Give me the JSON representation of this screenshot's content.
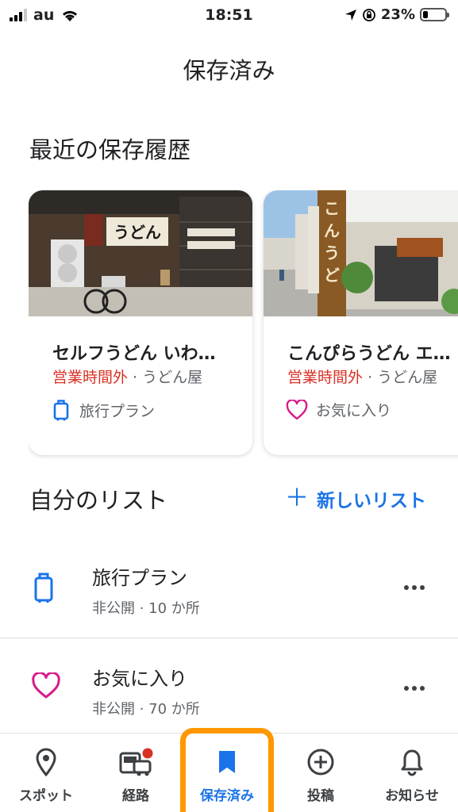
{
  "status_bar": {
    "carrier": "au",
    "time": "18:51",
    "battery": "23%",
    "battery_level": 0.23
  },
  "header": {
    "title": "保存済み"
  },
  "recent": {
    "title": "最近の保存履歴",
    "cards": [
      {
        "name": "セルフうどん いわ…",
        "status": "営業時間外",
        "separator": " · ",
        "category": "うどん屋",
        "list_label": "旅行プラン",
        "list_icon": "luggage-icon",
        "sign_text": "うどん"
      },
      {
        "name": "こんぴらうどん エ…",
        "status": "営業時間外",
        "separator": " · ",
        "category": "うどん屋",
        "list_label": "お気に入り",
        "list_icon": "heart-icon",
        "sign_text": "こんぴらうどん"
      }
    ]
  },
  "my_lists": {
    "title": "自分のリスト",
    "new_list_label": "新しいリスト",
    "items": [
      {
        "name": "旅行プラン",
        "meta": "非公開 · 10 か所",
        "icon": "luggage-icon"
      },
      {
        "name": "お気に入り",
        "meta": "非公開 · 70 か所",
        "icon": "heart-icon"
      }
    ]
  },
  "bottom_nav": [
    {
      "label": "スポット",
      "icon": "location-pin-icon"
    },
    {
      "label": "経路",
      "icon": "commute-icon"
    },
    {
      "label": "保存済み",
      "icon": "bookmark-icon",
      "active": true
    },
    {
      "label": "投稿",
      "icon": "add-circle-icon"
    },
    {
      "label": "お知らせ",
      "icon": "bell-icon"
    }
  ],
  "colors": {
    "accent": "#1a73e8",
    "closed": "#d93025",
    "heart": "#d81b8a",
    "highlight": "#ff9800"
  }
}
